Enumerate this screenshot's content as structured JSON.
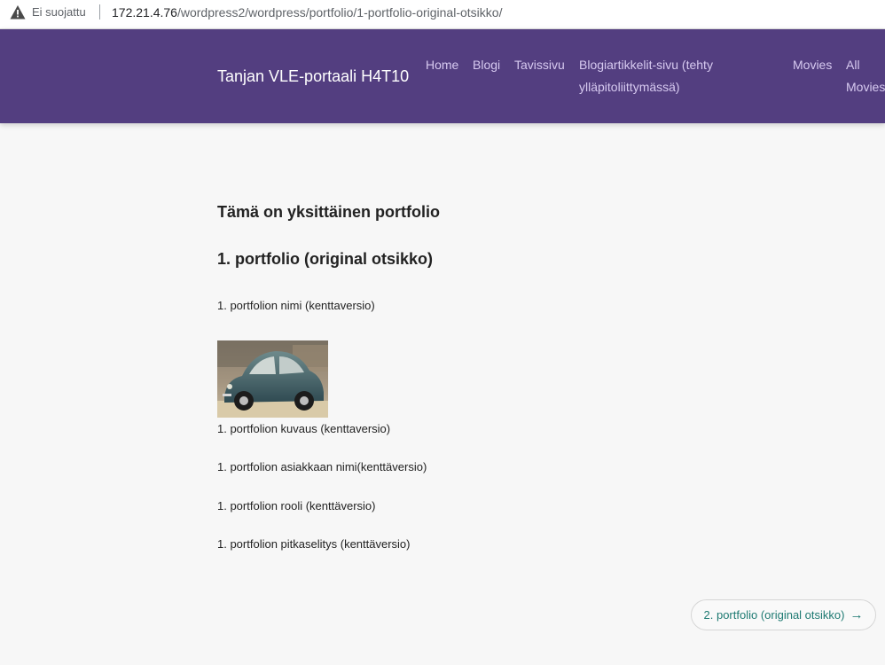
{
  "browser": {
    "security_label": "Ei suojattu",
    "url_host": "172.21.4.76",
    "url_path": "/wordpress2/wordpress/portfolio/1-portfolio-original-otsikko/"
  },
  "header": {
    "site_title": "Tanjan VLE-portaali H4T10",
    "nav": {
      "home": "Home",
      "blogi": "Blogi",
      "tavissivu": "Tavissivu",
      "blogiartikkelit": "Blogiartikkelit-sivu (tehty ylläpitoliittymässä)",
      "movies": "Movies",
      "all_movies": "All Movies"
    },
    "bg_color": "#533e80"
  },
  "main": {
    "page_heading": "Tämä on yksittäinen portfolio",
    "portfolio_title": "1. portfolio (original otsikko)",
    "portfolio_name": "1. portfolion nimi (kenttaversio)",
    "portfolio_description": "1. portfolion kuvaus (kenttaversio)",
    "portfolio_client": "1. portfolion asiakkaan nimi(kenttäversio)",
    "portfolio_role": "1. portfolion rooli (kenttäversio)",
    "portfolio_long_desc": "1. portfolion pitkaselitys (kenttäversio)",
    "image_icon": "car-photo"
  },
  "pagination": {
    "next_label": "2. portfolio (original otsikko)",
    "next_arrow": "→"
  }
}
